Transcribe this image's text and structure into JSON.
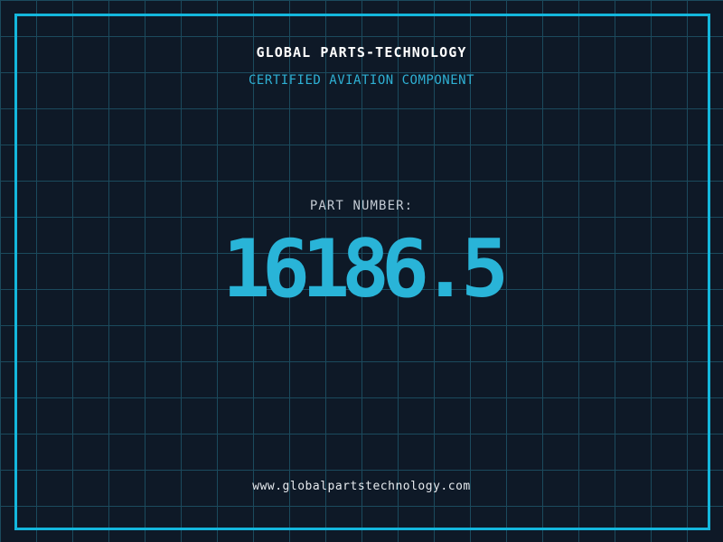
{
  "header": {
    "title": "GLOBAL PARTS-TECHNOLOGY",
    "subtitle": "CERTIFIED AVIATION COMPONENT"
  },
  "part": {
    "label": "PART NUMBER:",
    "number": "16186.5"
  },
  "footer": {
    "website": "www.globalpartstechnology.com"
  },
  "colors": {
    "background": "#0e1927",
    "grid_line": "#1b4a5d",
    "frame_accent": "#14b7dd",
    "number_accent": "#29b4d8",
    "title_text": "#ffffff",
    "muted_text": "#c3cad3"
  }
}
